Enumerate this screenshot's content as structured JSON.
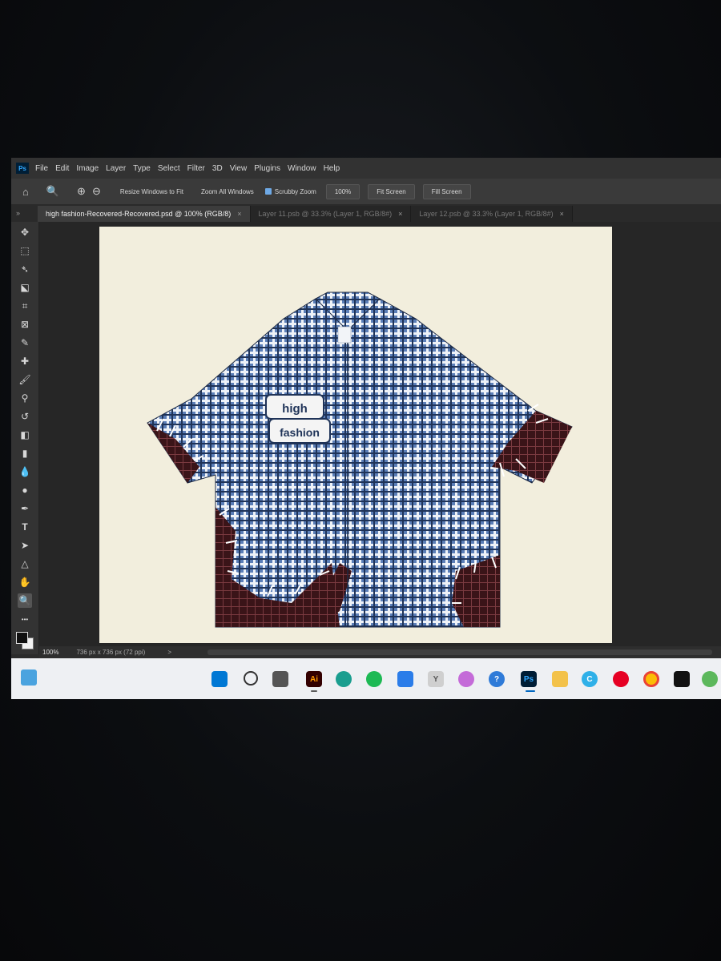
{
  "app": {
    "logo_text": "Ps"
  },
  "menu": [
    "File",
    "Edit",
    "Image",
    "Layer",
    "Type",
    "Select",
    "Filter",
    "3D",
    "View",
    "Plugins",
    "Window",
    "Help"
  ],
  "options_bar": {
    "resize_windows": "Resize Windows to Fit",
    "zoom_all_windows": "Zoom All Windows",
    "scrubby_zoom": "Scrubby Zoom",
    "zoom_value": "100%",
    "fit_screen": "Fit Screen",
    "fill_screen": "Fill Screen"
  },
  "tabs": [
    {
      "title": "high fashion-Recovered-Recovered.psd @ 100% (RGB/8)",
      "active": true
    },
    {
      "title": "Layer 11.psb @ 33.3% (Layer 1, RGB/8#)",
      "active": false
    },
    {
      "title": "Layer 12.psb @ 33.3% (Layer 1, RGB/8#)",
      "active": false
    }
  ],
  "tab_close_glyph": "×",
  "toolbar_collapse": "»",
  "tools": [
    {
      "name": "move-tool",
      "glyph": "✥"
    },
    {
      "name": "marquee-tool",
      "glyph": "⬚"
    },
    {
      "name": "lasso-tool",
      "glyph": "➴"
    },
    {
      "name": "object-select-tool",
      "glyph": "⬕"
    },
    {
      "name": "crop-tool",
      "glyph": "⌗"
    },
    {
      "name": "frame-tool",
      "glyph": "⊠"
    },
    {
      "name": "eyedropper-tool",
      "glyph": "✎"
    },
    {
      "name": "healing-tool",
      "glyph": "✚"
    },
    {
      "name": "brush-tool",
      "glyph": "🖌"
    },
    {
      "name": "stamp-tool",
      "glyph": "⚲"
    },
    {
      "name": "history-brush-tool",
      "glyph": "↺"
    },
    {
      "name": "eraser-tool",
      "glyph": "◧"
    },
    {
      "name": "gradient-tool",
      "glyph": "▮"
    },
    {
      "name": "blur-tool",
      "glyph": "💧"
    },
    {
      "name": "dodge-tool",
      "glyph": "●"
    },
    {
      "name": "pen-tool",
      "glyph": "✒"
    },
    {
      "name": "type-tool",
      "glyph": "T"
    },
    {
      "name": "path-select-tool",
      "glyph": "➤"
    },
    {
      "name": "shape-tool",
      "glyph": "△"
    },
    {
      "name": "hand-tool",
      "glyph": "✋"
    },
    {
      "name": "zoom-tool",
      "glyph": "🔍"
    },
    {
      "name": "more-tools",
      "glyph": "•••"
    }
  ],
  "status": {
    "zoom": "100%",
    "doc_info": "736 px x 736 px (72 ppi)",
    "arrow": ">"
  },
  "artwork": {
    "patch_line1": "high",
    "patch_line2": "fashion"
  },
  "taskbar": {
    "apps": [
      {
        "name": "windows-start",
        "label": ""
      },
      {
        "name": "search",
        "label": ""
      },
      {
        "name": "task-view",
        "label": ""
      },
      {
        "name": "illustrator",
        "label": "Ai"
      },
      {
        "name": "edge",
        "label": ""
      },
      {
        "name": "spotify",
        "label": ""
      },
      {
        "name": "store",
        "label": ""
      },
      {
        "name": "yahoo",
        "label": "Y"
      },
      {
        "name": "copilot",
        "label": ""
      },
      {
        "name": "help",
        "label": "?"
      },
      {
        "name": "photoshop",
        "label": "Ps"
      },
      {
        "name": "file-explorer",
        "label": ""
      },
      {
        "name": "app-c",
        "label": "C"
      },
      {
        "name": "pinterest",
        "label": ""
      },
      {
        "name": "chrome",
        "label": ""
      },
      {
        "name": "app-hex",
        "label": ""
      },
      {
        "name": "utorrent",
        "label": ""
      }
    ]
  },
  "colors": {
    "shirt_blue": "#5b7eb7",
    "shirt_dark": "#1f3358",
    "patch_maroon": "#3a1418",
    "canvas_bg": "#f2eedd"
  }
}
